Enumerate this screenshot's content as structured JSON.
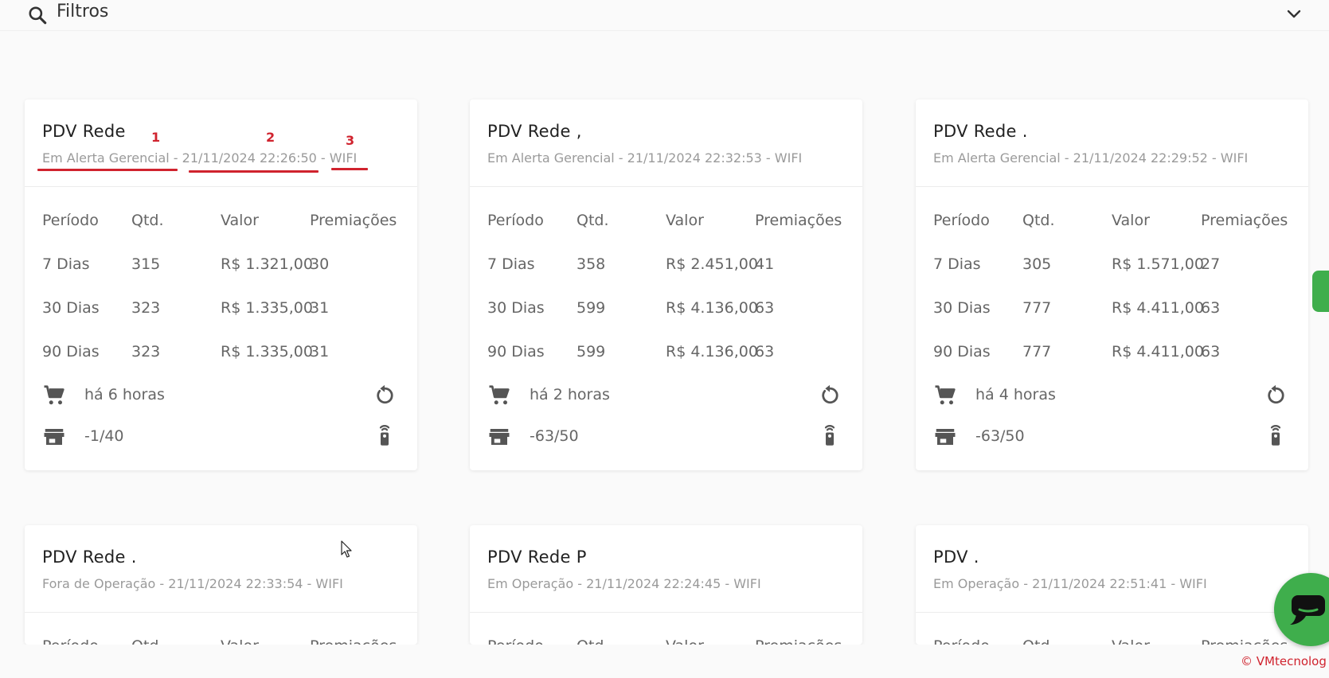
{
  "filters": {
    "title": "Filtros",
    "icon": "search-icon",
    "toggle_icon": "chevron-down-icon"
  },
  "table_headers": [
    "Período",
    "Qtd.",
    "Valor",
    "Premiações"
  ],
  "cards": [
    {
      "name": "PDV Rede",
      "status": "Em Alerta Gerencial",
      "datetime": "21/11/2024 22:26:50",
      "connection": "WIFI",
      "rows": [
        [
          "7 Dias",
          "315",
          "R$ 1.321,00",
          "30"
        ],
        [
          "30 Dias",
          "323",
          "R$ 1.335,00",
          "31"
        ],
        [
          "90 Dias",
          "323",
          "R$ 1.335,00",
          "31"
        ]
      ],
      "last_sale": "há 6 horas",
      "stock": "-1/40"
    },
    {
      "name": "PDV Rede ,",
      "status": "Em Alerta Gerencial",
      "datetime": "21/11/2024 22:32:53",
      "connection": "WIFI",
      "rows": [
        [
          "7 Dias",
          "358",
          "R$ 2.451,00",
          "41"
        ],
        [
          "30 Dias",
          "599",
          "R$ 4.136,00",
          "63"
        ],
        [
          "90 Dias",
          "599",
          "R$ 4.136,00",
          "63"
        ]
      ],
      "last_sale": "há 2 horas",
      "stock": "-63/50"
    },
    {
      "name": "PDV Rede .",
      "status": "Em Alerta Gerencial",
      "datetime": "21/11/2024 22:29:52",
      "connection": "WIFI",
      "rows": [
        [
          "7 Dias",
          "305",
          "R$ 1.571,00",
          "27"
        ],
        [
          "30 Dias",
          "777",
          "R$ 4.411,00",
          "63"
        ],
        [
          "90 Dias",
          "777",
          "R$ 4.411,00",
          "63"
        ]
      ],
      "last_sale": "há 4 horas",
      "stock": "-63/50"
    },
    {
      "name": "PDV Rede .",
      "status": "Fora de Operação",
      "datetime": "21/11/2024 22:33:54",
      "connection": "WIFI"
    },
    {
      "name": "PDV Rede P",
      "status": "Em Operação",
      "datetime": "21/11/2024 22:24:45",
      "connection": "WIFI"
    },
    {
      "name": "PDV .",
      "status": "Em Operação",
      "datetime": "21/11/2024 22:51:41",
      "connection": "WIFI"
    }
  ],
  "annotations": [
    "1",
    "2",
    "3"
  ],
  "footer": {
    "brand": "© VMtecnolog"
  },
  "colors": {
    "accent_green": "#3fae4c",
    "annotation_red": "#d0232e"
  }
}
